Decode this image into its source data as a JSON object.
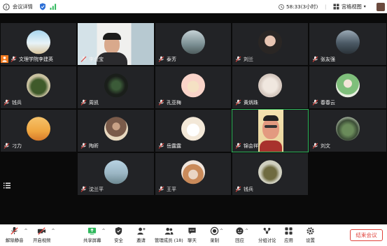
{
  "titlebar": {
    "meeting_info": "会议详情",
    "timer": "58:33(3小时)",
    "view_mode": "宫格视图"
  },
  "participants": [
    {
      "name": "文理学院李建英",
      "avatar": "sky-sea",
      "row": 0,
      "col": 0,
      "host": true
    },
    {
      "name": "李金宝",
      "avatar": "video-man",
      "row": 0,
      "col": 1
    },
    {
      "name": "泰芳",
      "avatar": "mountain",
      "row": 0,
      "col": 2
    },
    {
      "name": "刘兰",
      "avatar": "girl-dark",
      "row": 0,
      "col": 3
    },
    {
      "name": "张友强",
      "avatar": "mountain-dark",
      "row": 0,
      "col": 4
    },
    {
      "name": "钱兵",
      "avatar": "nature",
      "row": 1,
      "col": 0
    },
    {
      "name": "周凯",
      "avatar": "dark-green",
      "row": 1,
      "col": 1
    },
    {
      "name": "孔亚梅",
      "avatar": "cartoon-girl",
      "row": 1,
      "col": 2
    },
    {
      "name": "黄炳珠",
      "avatar": "baby",
      "row": 1,
      "col": 3
    },
    {
      "name": "春春云",
      "avatar": "girl-green",
      "row": 1,
      "col": 4
    },
    {
      "name": "刁力",
      "avatar": "sunset",
      "row": 2,
      "col": 0
    },
    {
      "name": "陶昕",
      "avatar": "desk-girl",
      "row": 2,
      "col": 1
    },
    {
      "name": "岳露露",
      "avatar": "cartoon-white",
      "row": 2,
      "col": 2
    },
    {
      "name": "锦会祥",
      "avatar": "video-man2",
      "row": 2,
      "col": 3,
      "active": true
    },
    {
      "name": "刘文",
      "avatar": "forest",
      "row": 2,
      "col": 4
    },
    {
      "name": "沈兰平",
      "avatar": "lake",
      "row": 3,
      "col": 1
    },
    {
      "name": "王平",
      "avatar": "hat-girl",
      "row": 3,
      "col": 2
    },
    {
      "name": "钱兵",
      "avatar": "nature2",
      "row": 3,
      "col": 3
    }
  ],
  "toolbar": {
    "mute": "解除静音",
    "video": "开启视频",
    "share": "共享屏幕",
    "security": "安全",
    "invite": "邀请",
    "members": "管理成员 (18)",
    "chat": "聊天",
    "record": "录制",
    "reactions": "回应",
    "breakout": "分组讨论",
    "apps": "应用",
    "settings": "设置",
    "end": "结束会议"
  },
  "colors": {
    "accent_green": "#2fb85c",
    "end_red": "#e0423b",
    "host_orange": "#f07a1f",
    "tile_bg": "#222326"
  }
}
